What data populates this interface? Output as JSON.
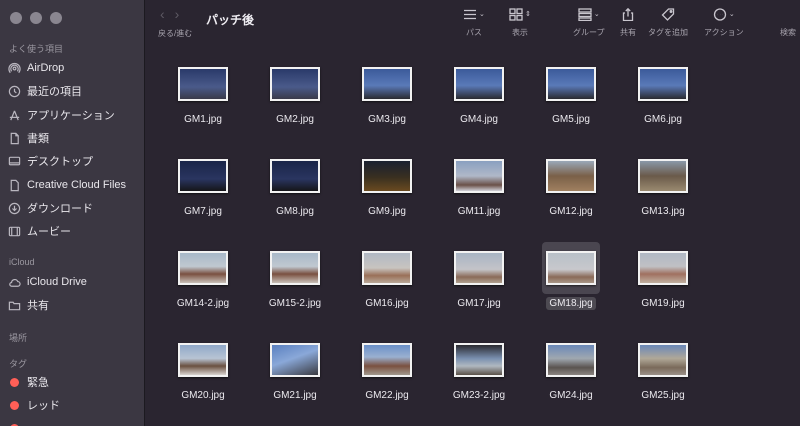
{
  "window": {
    "title": "パッチ後",
    "nav_label": "戻る/進む"
  },
  "toolbar": {
    "path_label": "パス",
    "view_label": "表示",
    "group_label": "グループ",
    "share_label": "共有",
    "tag_label": "タグを追加",
    "action_label": "アクション",
    "search_label": "検索"
  },
  "sidebar": {
    "favorites_header": "よく使う項目",
    "favorites": [
      {
        "label": "AirDrop",
        "icon": "airdrop-icon"
      },
      {
        "label": "最近の項目",
        "icon": "clock-icon"
      },
      {
        "label": "アプリケーション",
        "icon": "applications-icon"
      },
      {
        "label": "書類",
        "icon": "document-icon"
      },
      {
        "label": "デスクトップ",
        "icon": "desktop-icon"
      },
      {
        "label": "Creative Cloud Files",
        "icon": "file-icon"
      },
      {
        "label": "ダウンロード",
        "icon": "download-icon"
      },
      {
        "label": "ムービー",
        "icon": "movie-icon"
      }
    ],
    "icloud_header": "iCloud",
    "icloud": [
      {
        "label": "iCloud Drive",
        "icon": "cloud-icon"
      },
      {
        "label": "共有",
        "icon": "shared-folder-icon"
      }
    ],
    "locations_header": "場所",
    "tags_header": "タグ",
    "tags": [
      {
        "label": "緊急",
        "color": "#ff5f57"
      },
      {
        "label": "レッド",
        "color": "#ff5f57"
      }
    ]
  },
  "files": [
    {
      "name": "GM1.jpg",
      "thumb": "linear-gradient(180deg,#2a3a6a 0%,#4a5a8a 60%,#3a3a4a 100%)"
    },
    {
      "name": "GM2.jpg",
      "thumb": "linear-gradient(180deg,#2a3a6a 0%,#4a5a8a 60%,#3a3a4a 100%)"
    },
    {
      "name": "GM3.jpg",
      "thumb": "linear-gradient(180deg,#3b5a9a 0%,#5a7ab8 55%,#2a2a30 100%)"
    },
    {
      "name": "GM4.jpg",
      "thumb": "linear-gradient(180deg,#3b5a9a 0%,#5a7ab8 55%,#2a2a30 100%)"
    },
    {
      "name": "GM5.jpg",
      "thumb": "linear-gradient(180deg,#3b5a9a 0%,#5a7ab8 55%,#2a2a30 100%)"
    },
    {
      "name": "GM6.jpg",
      "thumb": "linear-gradient(180deg,#3b5a9a 0%,#5a7ab8 55%,#2a2a30 100%)"
    },
    {
      "name": "GM7.jpg",
      "thumb": "linear-gradient(180deg,#1a2548 0%,#2a3560 60%,#151518 100%)"
    },
    {
      "name": "GM8.jpg",
      "thumb": "linear-gradient(180deg,#1a2548 0%,#2a3560 60%,#151518 100%)"
    },
    {
      "name": "GM9.jpg",
      "thumb": "linear-gradient(180deg,#1a2030 0%,#3a3020 55%,#6a4a20 100%)"
    },
    {
      "name": "GM11.jpg",
      "thumb": "linear-gradient(180deg,#8aa0c0 0%,#b0b8c8 50%,#6a5048 80%,#d0d0d8 100%)"
    },
    {
      "name": "GM12.jpg",
      "thumb": "linear-gradient(180deg,#9aa8b8 0%,#7a6048 50%,#a08060 100%)"
    },
    {
      "name": "GM13.jpg",
      "thumb": "linear-gradient(180deg,#8a98a8 0%,#6a5a4a 50%,#9a8a70 100%)"
    },
    {
      "name": "GM14-2.jpg",
      "thumb": "linear-gradient(180deg,#a8b8c8 0%,#c0c8d0 45%,#7a5040 70%,#c8c0b8 100%)"
    },
    {
      "name": "GM15-2.jpg",
      "thumb": "linear-gradient(180deg,#a8b8c8 0%,#c0c8d0 45%,#7a5040 70%,#c8c0b8 100%)"
    },
    {
      "name": "GM16.jpg",
      "thumb": "linear-gradient(180deg,#b0b8c4 0%,#c8c4c0 50%,#9a7058 75%,#b8a898 100%)"
    },
    {
      "name": "GM17.jpg",
      "thumb": "linear-gradient(180deg,#a8b4c4 0%,#c4c4c8 55%,#8a6a58 80%,#b0a090 100%)"
    },
    {
      "name": "GM18.jpg",
      "thumb": "linear-gradient(180deg,#b8c0c8 0%,#c8c8cc 55%,#8a6a58 80%,#a89888 100%)"
    },
    {
      "name": "GM19.jpg",
      "thumb": "linear-gradient(180deg,#b0b8c4 0%,#c0c0c4 45%,#a07060 70%,#c0b0a0 100%)"
    },
    {
      "name": "GM20.jpg",
      "thumb": "linear-gradient(180deg,#90a8c8 0%,#b8c4d4 45%,#6a5040 70%,#d8d4d0 100%)"
    },
    {
      "name": "GM21.jpg",
      "thumb": "linear-gradient(160deg,#5a80c0 0%,#8aa8d8 45%,#3a3a40 100%)"
    },
    {
      "name": "GM22.jpg",
      "thumb": "linear-gradient(180deg,#6a90c8 0%,#9ab0d0 40%,#7a5040 70%,#a0988c 100%)"
    },
    {
      "name": "GM23-2.jpg",
      "thumb": "linear-gradient(180deg,#2a2a30 0%,#7a90b0 45%,#b0b8c0 70%,#5a5048 100%)"
    },
    {
      "name": "GM24.jpg",
      "thumb": "linear-gradient(180deg,#6a88b8 0%,#a0a8b0 45%,#5a5450 75%,#8a8480 100%)"
    },
    {
      "name": "GM25.jpg",
      "thumb": "linear-gradient(180deg,#6a88b8 0%,#b0a898 45%,#7a6a5a 75%,#9a9088 100%)"
    }
  ],
  "selected_file": "GM18.jpg"
}
